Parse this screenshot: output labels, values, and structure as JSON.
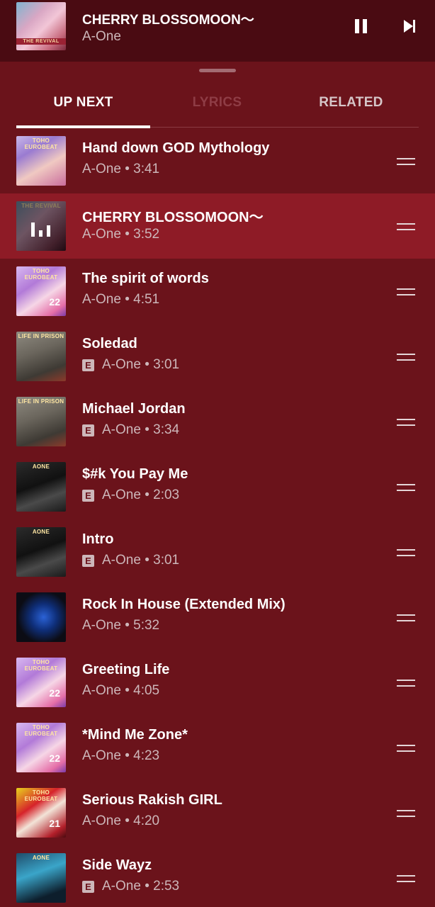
{
  "mini_player": {
    "title": "CHERRY BLOSSOMOON〜",
    "artist": "A-One",
    "art_label": "THE REVIVAL",
    "pause_icon": "pause-icon",
    "next_icon": "skip-next-icon"
  },
  "tabs": [
    {
      "label": "UP NEXT",
      "state": "selected"
    },
    {
      "label": "LYRICS",
      "state": "disabled"
    },
    {
      "label": "RELATED",
      "state": "normal"
    }
  ],
  "queue": [
    {
      "title": "Hand down GOD Mythology",
      "subtitle": "A-One • 3:41",
      "explicit": false,
      "art": "idol",
      "art_label": "TOHO EUROBEAT",
      "art_num": ""
    },
    {
      "title": "CHERRY BLOSSOMOON〜",
      "subtitle": "A-One • 3:52",
      "explicit": false,
      "art": "cherry",
      "art_label": "THE REVIVAL",
      "art_num": "",
      "playing": true
    },
    {
      "title": "The spirit of words",
      "subtitle": "A-One • 4:51",
      "explicit": false,
      "art": "toho22",
      "art_label": "TOHO EUROBEAT",
      "art_num": "22"
    },
    {
      "title": "Soledad",
      "subtitle": "A-One • 3:01",
      "explicit": true,
      "art": "soledad",
      "art_label": "LIFE IN PRISON",
      "art_num": ""
    },
    {
      "title": "Michael Jordan",
      "subtitle": "A-One • 3:34",
      "explicit": true,
      "art": "soledad",
      "art_label": "LIFE IN PRISON",
      "art_num": ""
    },
    {
      "title": "$#k You Pay Me",
      "subtitle": "A-One • 2:03",
      "explicit": true,
      "art": "aone",
      "art_label": "AONE",
      "art_num": ""
    },
    {
      "title": "Intro",
      "subtitle": "A-One • 3:01",
      "explicit": true,
      "art": "aone",
      "art_label": "AONE",
      "art_num": ""
    },
    {
      "title": "Rock In House (Extended Mix)",
      "subtitle": "A-One • 5:32",
      "explicit": false,
      "art": "rock",
      "art_label": "",
      "art_num": ""
    },
    {
      "title": "Greeting Life",
      "subtitle": "A-One • 4:05",
      "explicit": false,
      "art": "toho22",
      "art_label": "TOHO EUROBEAT",
      "art_num": "22"
    },
    {
      "title": "*Mind Me Zone*",
      "subtitle": "A-One • 4:23",
      "explicit": false,
      "art": "toho22",
      "art_label": "TOHO EUROBEAT",
      "art_num": "22"
    },
    {
      "title": "Serious Rakish GIRL",
      "subtitle": "A-One • 4:20",
      "explicit": false,
      "art": "toho21",
      "art_label": "TOHO EUROBEAT",
      "art_num": "21"
    },
    {
      "title": "Side Wayz",
      "subtitle": "A-One • 2:53",
      "explicit": true,
      "art": "wayz",
      "art_label": "AONE",
      "art_num": ""
    }
  ],
  "explicit_badge": "E",
  "colors": {
    "background": "#6b131b",
    "mini_player_bg": "#4a0b12",
    "active_row": "#8e1b26",
    "secondary_text": "#cdb7ba"
  }
}
